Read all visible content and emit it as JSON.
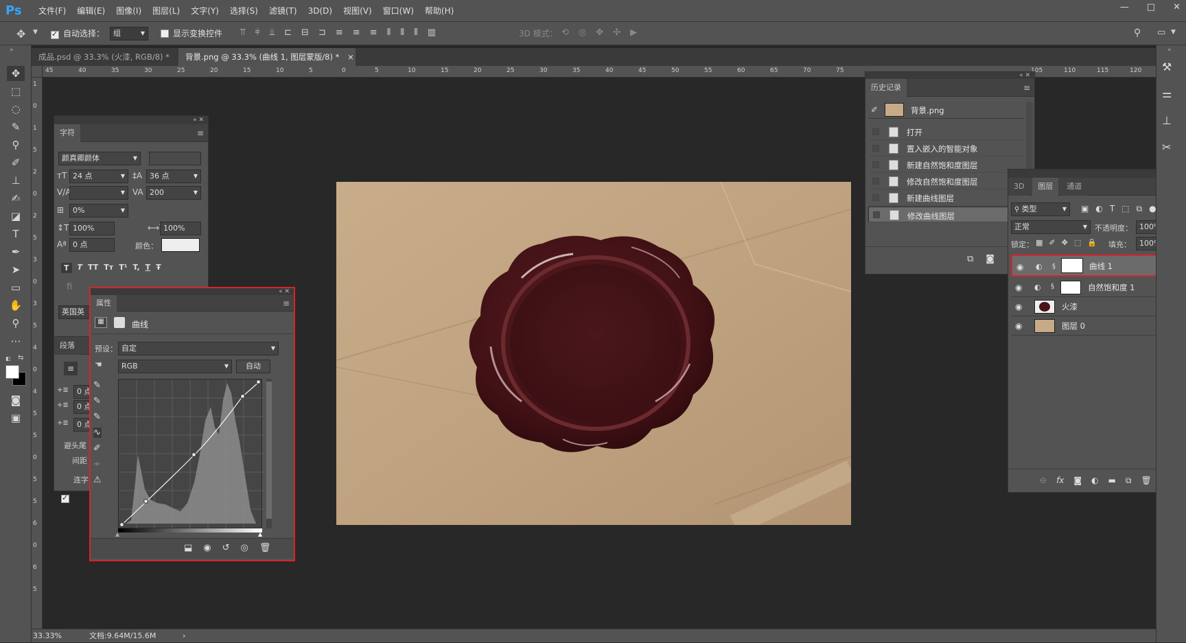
{
  "app": {
    "logo": "Ps"
  },
  "menu": [
    "文件(F)",
    "编辑(E)",
    "图像(I)",
    "图层(L)",
    "文字(Y)",
    "选择(S)",
    "滤镜(T)",
    "3D(D)",
    "视图(V)",
    "窗口(W)",
    "帮助(H)"
  ],
  "window_controls": [
    "—",
    "□",
    "✕"
  ],
  "options": {
    "auto_select_label": "自动选择：",
    "auto_select_value": "组",
    "show_transform_label": "显示变换控件",
    "mode_3d_label": "3D 模式："
  },
  "tabs": [
    {
      "label": "成品.psd @ 33.3% (火漆, RGB/8) *",
      "close": "×"
    },
    {
      "label": "背景.png @ 33.3% (曲线 1, 图层蒙版/8) *",
      "close": "×"
    }
  ],
  "ruler_h": [
    "45",
    "40",
    "35",
    "30",
    "25",
    "20",
    "15",
    "10",
    "5",
    "0",
    "5",
    "10",
    "15",
    "20",
    "25",
    "30",
    "35",
    "40",
    "45",
    "50",
    "55",
    "60",
    "65",
    "70",
    "75",
    "105",
    "110",
    "115",
    "120"
  ],
  "ruler_v": [
    "1",
    "0",
    "1",
    "5",
    "2",
    "0",
    "2",
    "5",
    "3",
    "0",
    "3",
    "5",
    "4",
    "0",
    "4",
    "5",
    "5",
    "0",
    "5",
    "5",
    "6",
    "0",
    "6",
    "5"
  ],
  "status": {
    "zoom": "33.33%",
    "doc": "文档:9.64M/15.6M",
    "arrow": "›"
  },
  "character_panel": {
    "tab": "字符",
    "font_family": "颜真卿颜体",
    "font_size": "24 点",
    "leading": "36 点",
    "tracking": "200",
    "scale_pct": "0%",
    "v_scale": "100%",
    "h_scale": "100%",
    "baseline": "0 点",
    "color_label": "颜色：",
    "language": "英国英",
    "fi": "fi",
    "style_buttons": [
      "T",
      "T",
      "TT",
      "Tт",
      "T¹",
      "T,",
      "T",
      "Ŧ"
    ]
  },
  "paragraph_panel": {
    "tab": "段落",
    "indent_values": [
      "0 点",
      "0 点",
      "0 点"
    ],
    "hyphen_label": "避头尾",
    "spacing_label": "间距",
    "connect_label": "连字"
  },
  "properties_panel": {
    "tab": "属性",
    "title": "曲线",
    "preset_label": "预设：",
    "preset_value": "自定",
    "channel": "RGB",
    "auto_button": "自动"
  },
  "history_panel": {
    "tab": "历史记录",
    "snapshot": "背景.png",
    "items": [
      "打开",
      "置入嵌入的智能对象",
      "新建自然饱和度图层",
      "修改自然饱和度图层",
      "新建曲线图层",
      "修改曲线图层"
    ]
  },
  "layers_panel": {
    "tabs": [
      "3D",
      "图层",
      "通道"
    ],
    "filter_label": "类型",
    "blend_mode": "正常",
    "opacity_label": "不透明度：",
    "opacity_value": "100%",
    "lock_label": "锁定：",
    "fill_label": "填充：",
    "fill_value": "100%",
    "layers": [
      "曲线 1",
      "自然饱和度 1",
      "火漆",
      "图层 0"
    ]
  },
  "colors": {
    "accent_red": "#d9232d",
    "ps_blue": "#31a8ff",
    "wax": "#4a1418",
    "paper": "#c3a684"
  }
}
